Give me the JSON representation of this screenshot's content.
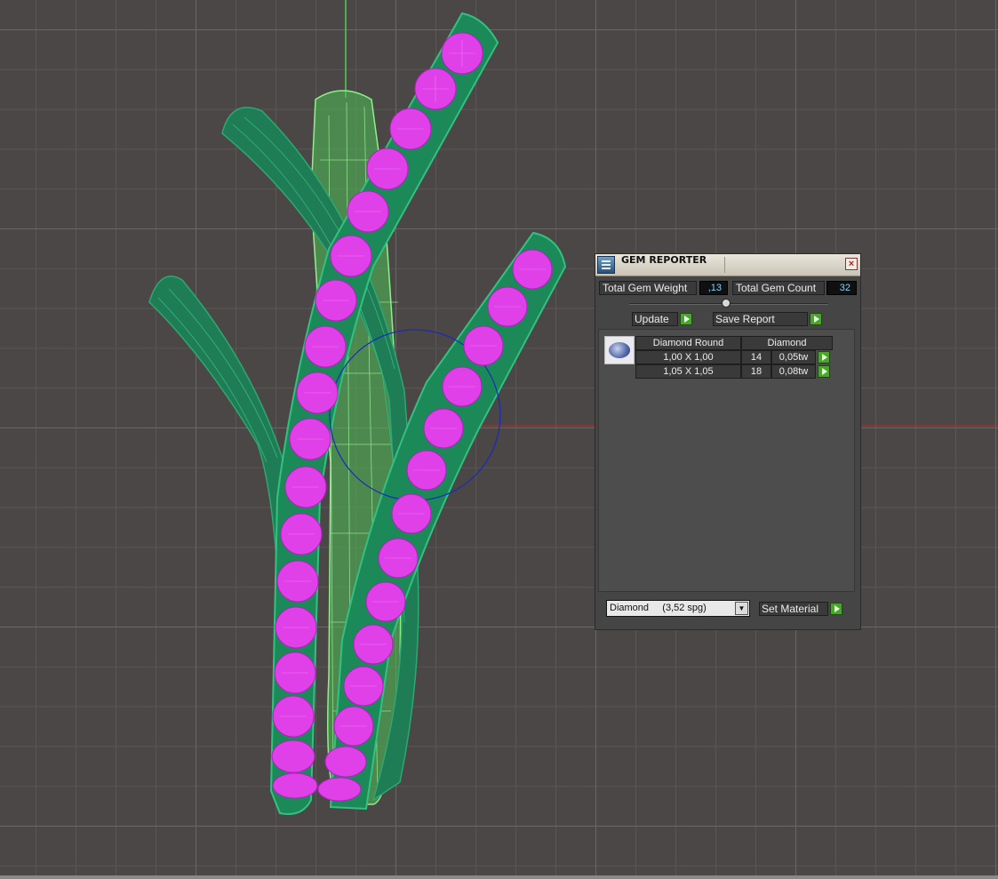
{
  "colors": {
    "viewport_bg": "#4b4747",
    "grid_major": "#6a6666",
    "grid_minor": "#5a5656",
    "gem": "#e040e8",
    "metal": "#1f8c5c",
    "wire_light": "#6fd66a",
    "axis_x": "#c02a2a",
    "axis_y": "#4ad04a",
    "gizmo": "#1a2ab8"
  },
  "gem_reporter": {
    "title": "GEM REPORTER",
    "close_icon": "close-icon",
    "total_weight_label": "Total Gem Weight",
    "total_weight_value": ",13",
    "total_count_label": "Total Gem Count",
    "total_count_value": "32",
    "update_label": "Update",
    "save_report_label": "Save Report",
    "table": {
      "headers": [
        "Diamond Round",
        "Diamond"
      ],
      "rows": [
        {
          "size": "1,00 X 1,00",
          "count": "14",
          "weight": "0,05tw"
        },
        {
          "size": "1,05 X 1,05",
          "count": "18",
          "weight": "0,08tw"
        }
      ]
    },
    "material_value": "Diamond     (3,52 spg)",
    "set_material_label": "Set Material"
  }
}
